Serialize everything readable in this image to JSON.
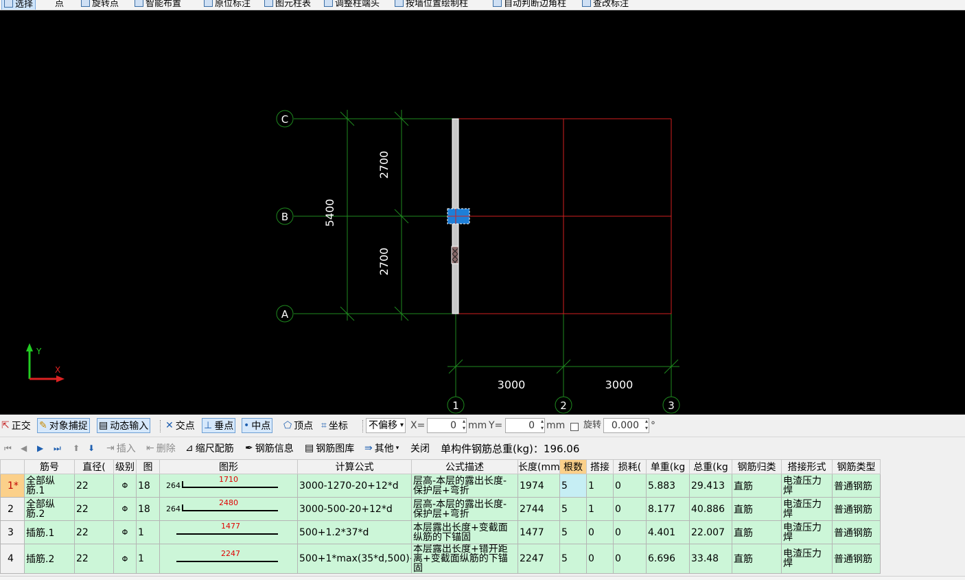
{
  "top_toolbar": {
    "items": [
      "选择",
      "点",
      "旋转点",
      "智能布置",
      "原位标注",
      "图元柱表",
      "调整柱端头",
      "按墙位置绘制柱",
      "自动判断边角柱",
      "查改标注"
    ]
  },
  "drawing": {
    "axis_labels_vertical": [
      "C",
      "B",
      "A"
    ],
    "axis_labels_horizontal": [
      "1",
      "2",
      "3"
    ],
    "dim_total_y": "5400",
    "dim_seg_y": [
      "2700",
      "2700"
    ],
    "dim_seg_x": [
      "3000",
      "3000"
    ],
    "ucs_y": "Y",
    "ucs_x": "X",
    "colors": {
      "grid": "#1f8a1f",
      "beam": "#d42020",
      "column": "#c8c8c8",
      "selection": "#1e7fd8",
      "background": "#000000",
      "text": "#ffffff"
    }
  },
  "snap_toolbar": {
    "ortho": "正交",
    "object_snap": "对象捕捉",
    "dynamic_input": "动态输入",
    "intersection": "交点",
    "perpendicular": "垂点",
    "midpoint": "中点",
    "vertex": "顶点",
    "coordinate": "坐标",
    "offset_select": "不偏移",
    "x_label": "X=",
    "x_value": "0",
    "x_unit": "mm",
    "y_label": "Y=",
    "y_value": "0",
    "y_unit": "mm",
    "rotate_label": "旋转",
    "rotate_value": "0.000",
    "degree": "°"
  },
  "rebar_toolbar": {
    "insert": "插入",
    "delete": "删除",
    "scale_rebar": "缩尺配筋",
    "rebar_info": "钢筋信息",
    "rebar_library": "钢筋图库",
    "other": "其他",
    "close": "关闭",
    "total_weight": "单构件钢筋总重(kg)：196.06"
  },
  "table": {
    "headers": [
      "",
      "筋号",
      "直径(",
      "级别",
      "图",
      "图形",
      "计算公式",
      "公式描述",
      "长度(mm",
      "根数",
      "搭接",
      "损耗(",
      "单重(kg",
      "总重(kg",
      "钢筋归类",
      "搭接形式",
      "钢筋类型"
    ],
    "rows": [
      {
        "no": "1*",
        "name": "全部纵筋.1",
        "dia": "22",
        "grade": "Φ",
        "fig": "18",
        "shape_left": "264",
        "shape_val": "1710",
        "formula": "3000-1270-20+12*d",
        "desc": "层高-本层的露出长度-保护层+弯折",
        "length": "1974",
        "count": "5",
        "lap": "1",
        "loss": "0",
        "unit_w": "5.883",
        "total_w": "29.413",
        "category": "直筋",
        "lap_form": "电渣压力焊",
        "type": "普通钢筋"
      },
      {
        "no": "2",
        "name": "全部纵筋.2",
        "dia": "22",
        "grade": "Φ",
        "fig": "18",
        "shape_left": "264",
        "shape_val": "2480",
        "formula": "3000-500-20+12*d",
        "desc": "层高-本层的露出长度-保护层+弯折",
        "length": "2744",
        "count": "5",
        "lap": "1",
        "loss": "0",
        "unit_w": "8.177",
        "total_w": "40.886",
        "category": "直筋",
        "lap_form": "电渣压力焊",
        "type": "普通钢筋"
      },
      {
        "no": "3",
        "name": "插筋.1",
        "dia": "22",
        "grade": "Φ",
        "fig": "1",
        "shape_left": "",
        "shape_val": "1477",
        "formula": "500+1.2*37*d",
        "desc": "本层露出长度+变截面纵筋的下锚固",
        "length": "1477",
        "count": "5",
        "lap": "0",
        "loss": "0",
        "unit_w": "4.401",
        "total_w": "22.007",
        "category": "直筋",
        "lap_form": "电渣压力焊",
        "type": "普通钢筋"
      },
      {
        "no": "4",
        "name": "插筋.2",
        "dia": "22",
        "grade": "Φ",
        "fig": "1",
        "shape_left": "",
        "shape_val": "2247",
        "formula": "500+1*max(35*d,500)+1.2*37*d",
        "desc": "本层露出长度+错开距离+变截面纵筋的下锚固",
        "length": "2247",
        "count": "5",
        "lap": "0",
        "loss": "0",
        "unit_w": "6.696",
        "total_w": "33.48",
        "category": "直筋",
        "lap_form": "电渣压力焊",
        "type": "普通钢筋"
      }
    ]
  }
}
